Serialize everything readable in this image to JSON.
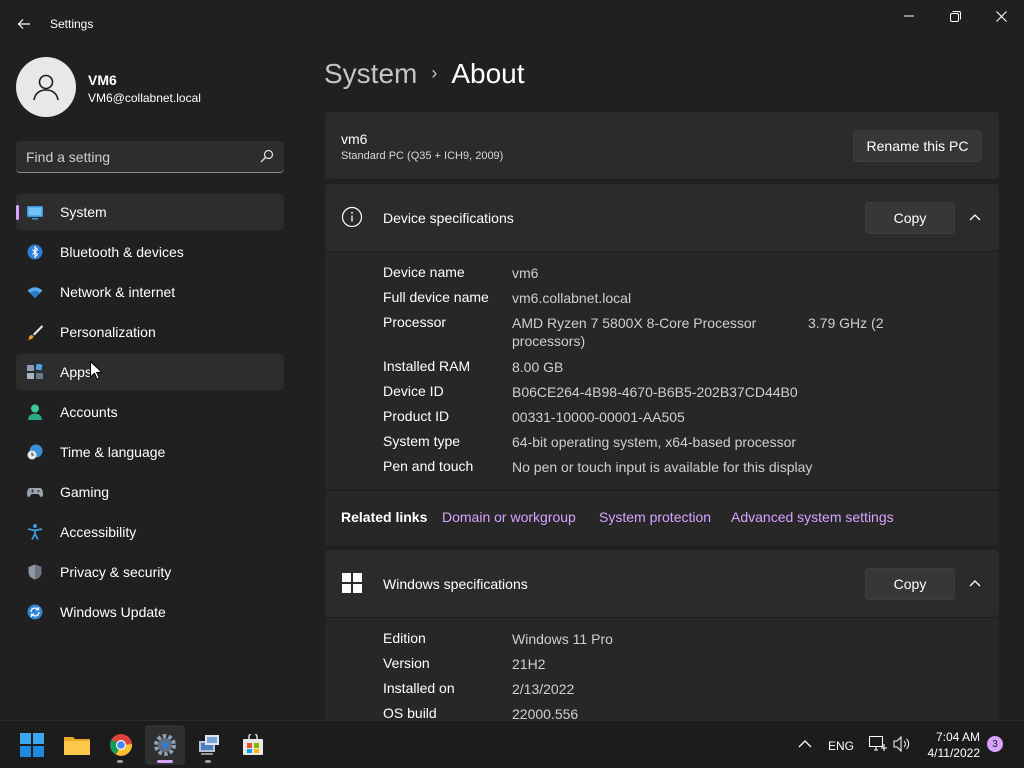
{
  "window": {
    "title": "Settings"
  },
  "user": {
    "name": "VM6",
    "email": "VM6@collabnet.local"
  },
  "search": {
    "placeholder": "Find a setting"
  },
  "nav": {
    "items": [
      {
        "label": "System",
        "icon": "monitor-icon"
      },
      {
        "label": "Bluetooth & devices",
        "icon": "bluetooth-icon"
      },
      {
        "label": "Network & internet",
        "icon": "wifi-icon"
      },
      {
        "label": "Personalization",
        "icon": "brush-icon"
      },
      {
        "label": "Apps",
        "icon": "apps-icon"
      },
      {
        "label": "Accounts",
        "icon": "person-icon"
      },
      {
        "label": "Time & language",
        "icon": "clock-globe-icon"
      },
      {
        "label": "Gaming",
        "icon": "gamepad-icon"
      },
      {
        "label": "Accessibility",
        "icon": "accessibility-icon"
      },
      {
        "label": "Privacy & security",
        "icon": "shield-icon"
      },
      {
        "label": "Windows Update",
        "icon": "update-icon"
      }
    ]
  },
  "breadcrumb": {
    "parent": "System",
    "separator": "›",
    "current": "About"
  },
  "pc": {
    "name": "vm6",
    "model": "Standard PC (Q35 + ICH9, 2009)",
    "rename_label": "Rename this PC"
  },
  "device_specs": {
    "title": "Device specifications",
    "copy_label": "Copy",
    "rows": [
      {
        "key": "Device name",
        "value": "vm6"
      },
      {
        "key": "Full device name",
        "value": "vm6.collabnet.local"
      },
      {
        "key": "Processor",
        "value": "AMD Ryzen 7 5800X 8-Core Processor processors)",
        "value2": "3.79 GHz (2"
      },
      {
        "key": "Installed RAM",
        "value": "8.00 GB"
      },
      {
        "key": "Device ID",
        "value": "B06CE264-4B98-4670-B6B5-202B37CD44B0"
      },
      {
        "key": "Product ID",
        "value": "00331-10000-00001-AA505"
      },
      {
        "key": "System type",
        "value": "64-bit operating system, x64-based processor"
      },
      {
        "key": "Pen and touch",
        "value": "No pen or touch input is available for this display"
      }
    ]
  },
  "related_links": {
    "title": "Related links",
    "links": [
      "Domain or workgroup",
      "System protection",
      "Advanced system settings"
    ]
  },
  "windows_specs": {
    "title": "Windows specifications",
    "copy_label": "Copy",
    "rows": [
      {
        "key": "Edition",
        "value": "Windows 11 Pro"
      },
      {
        "key": "Version",
        "value": "21H2"
      },
      {
        "key": "Installed on",
        "value": "2/13/2022"
      },
      {
        "key": "OS build",
        "value": "22000.556"
      }
    ]
  },
  "taskbar": {
    "apps": [
      "start-icon",
      "file-explorer-icon",
      "chrome-icon",
      "settings-icon",
      "network-tool-icon",
      "store-icon"
    ],
    "language": "ENG",
    "time": "7:04 AM",
    "date": "4/11/2022",
    "notification_count": "3"
  },
  "colors": {
    "accent": "#d7a3ff",
    "background": "#202020",
    "card": "#2b2b2b"
  }
}
